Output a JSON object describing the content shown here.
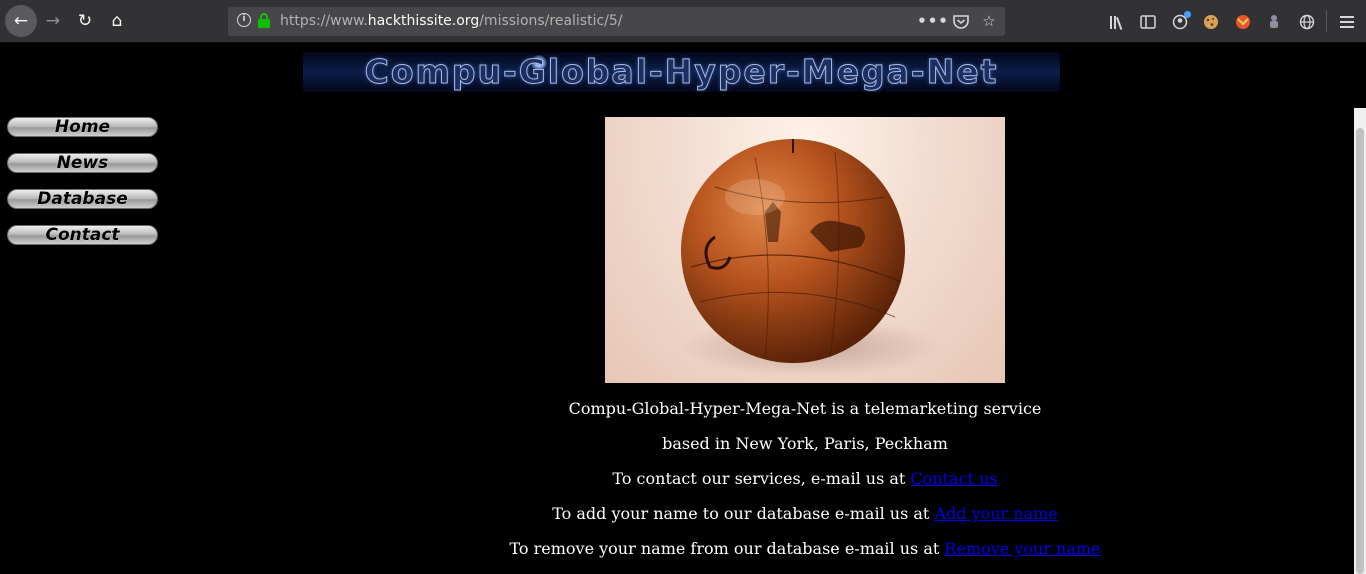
{
  "browser": {
    "url_prefix": "https://www.",
    "url_domain": "hackthissite.org",
    "url_path": "/missions/realistic/5/",
    "icons": [
      "back-icon",
      "forward-icon",
      "reload-icon",
      "home-icon",
      "info-icon",
      "lock-icon",
      "more-icon",
      "pocket-icon",
      "star-icon",
      "library-icon",
      "sidebar-icon",
      "account-icon",
      "cookie-icon",
      "fox-icon",
      "extension-icon",
      "globe-icon",
      "menu-icon"
    ]
  },
  "banner": {
    "title": "Compu-Global-Hyper-Mega-Net"
  },
  "nav": {
    "home": "Home",
    "news": "News",
    "database": "Database",
    "contact": "Contact"
  },
  "content": {
    "line1": "Compu-Global-Hyper-Mega-Net is a telemarketing service",
    "line2": "based in New York, Paris, Peckham",
    "line3_text": "To contact our services, e-mail us at ",
    "line3_link": "Contact us",
    "line4_text": "To add your name to our database e-mail us at ",
    "line4_link": "Add your name",
    "line5_text": "To remove your name from our database e-mail us at ",
    "line5_link": "Remove your name"
  },
  "colors": {
    "page_bg": "#000000",
    "text": "#ffffff",
    "link": "#0000ee",
    "toolbar": "#323234",
    "secure_lock": "#12bc00"
  }
}
